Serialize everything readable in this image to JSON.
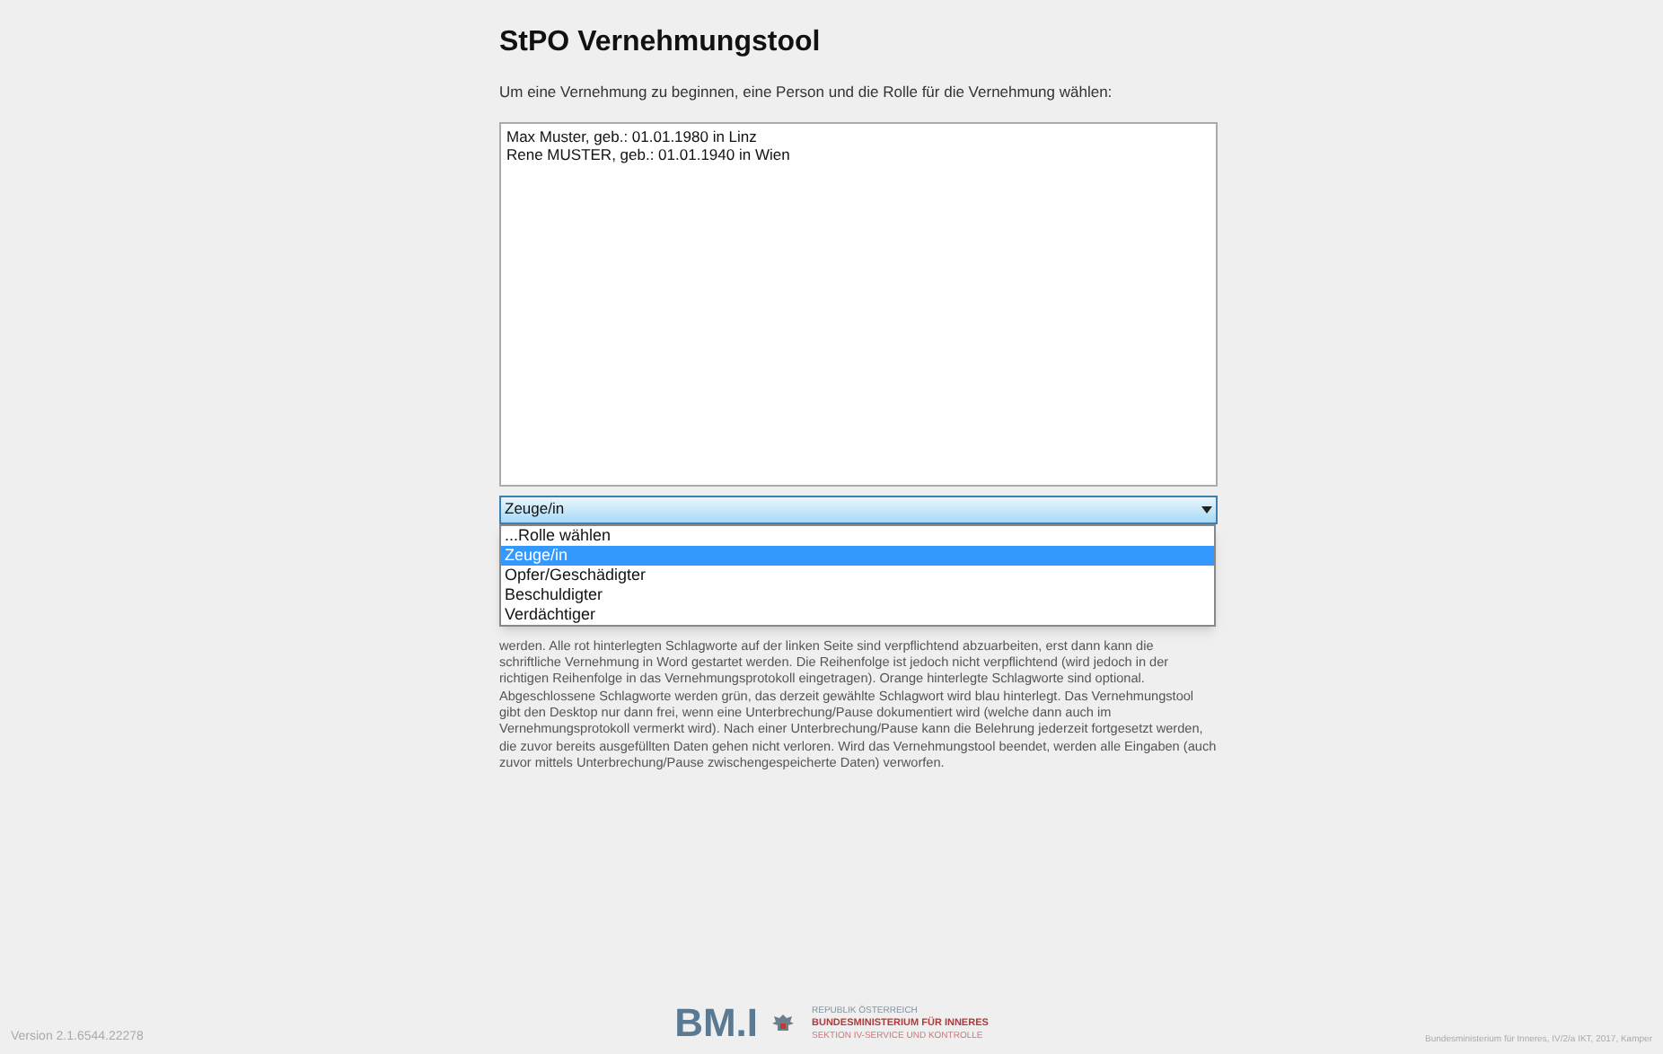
{
  "title": "StPO Vernehmungstool",
  "instruction": "Um eine Vernehmung zu beginnen, eine Person und die Rolle für die Vernehmung wählen:",
  "persons": [
    {
      "label": "Max Muster, geb.: 01.01.1980 in Linz",
      "selected": false
    },
    {
      "label": "Rene MUSTER, geb.: 01.01.1940 in Wien",
      "selected": false
    }
  ],
  "role_select": {
    "value": "Zeuge/in",
    "expanded": true,
    "options": [
      {
        "label": "...Rolle wählen",
        "selected": false
      },
      {
        "label": "Zeuge/in",
        "selected": true
      },
      {
        "label": "Opfer/Geschädigter",
        "selected": false
      },
      {
        "label": "Beschuldigter",
        "selected": false
      },
      {
        "label": "Verdächtiger",
        "selected": false
      }
    ]
  },
  "info_text": "werden. Alle rot hinterlegten Schlagworte auf der linken Seite sind verpflichtend abzuarbeiten, erst dann kann die schriftliche Vernehmung in Word gestartet werden. Die Reihenfolge ist jedoch nicht verpflichtend (wird jedoch in der richtigen Reihenfolge in das Vernehmungsprotokoll eingetragen). Orange hinterlegte Schlagworte sind optional. Abgeschlossene Schlagworte werden grün, das derzeit gewählte Schlagwort wird blau hinterlegt. Das Vernehmungstool gibt den Desktop nur dann frei, wenn eine Unterbrechung/Pause dokumentiert wird (welche dann auch im Vernehmungsprotokoll vermerkt wird). Nach einer Unterbrechung/Pause kann die Belehrung jederzeit fortgesetzt werden, die zuvor bereits ausgefüllten Daten gehen nicht verloren. Wird das Vernehmungstool beendet, werden alle Eingaben (auch zuvor mittels Unterbrechung/Pause zwischengespeicherte Daten) verworfen.",
  "footer": {
    "version": "Version 2.1.6544.22278",
    "logo": {
      "mark": "BM.I",
      "line_1": "REPUBLIK ÖSTERREICH",
      "line_2": "BUNDESMINISTERIUM FÜR INNERES",
      "line_3": "SEKTION IV-SERVICE UND KONTROLLE"
    },
    "credit": "Bundesministerium für Inneres, IV/2/a IKT, 2017, Kamper"
  }
}
